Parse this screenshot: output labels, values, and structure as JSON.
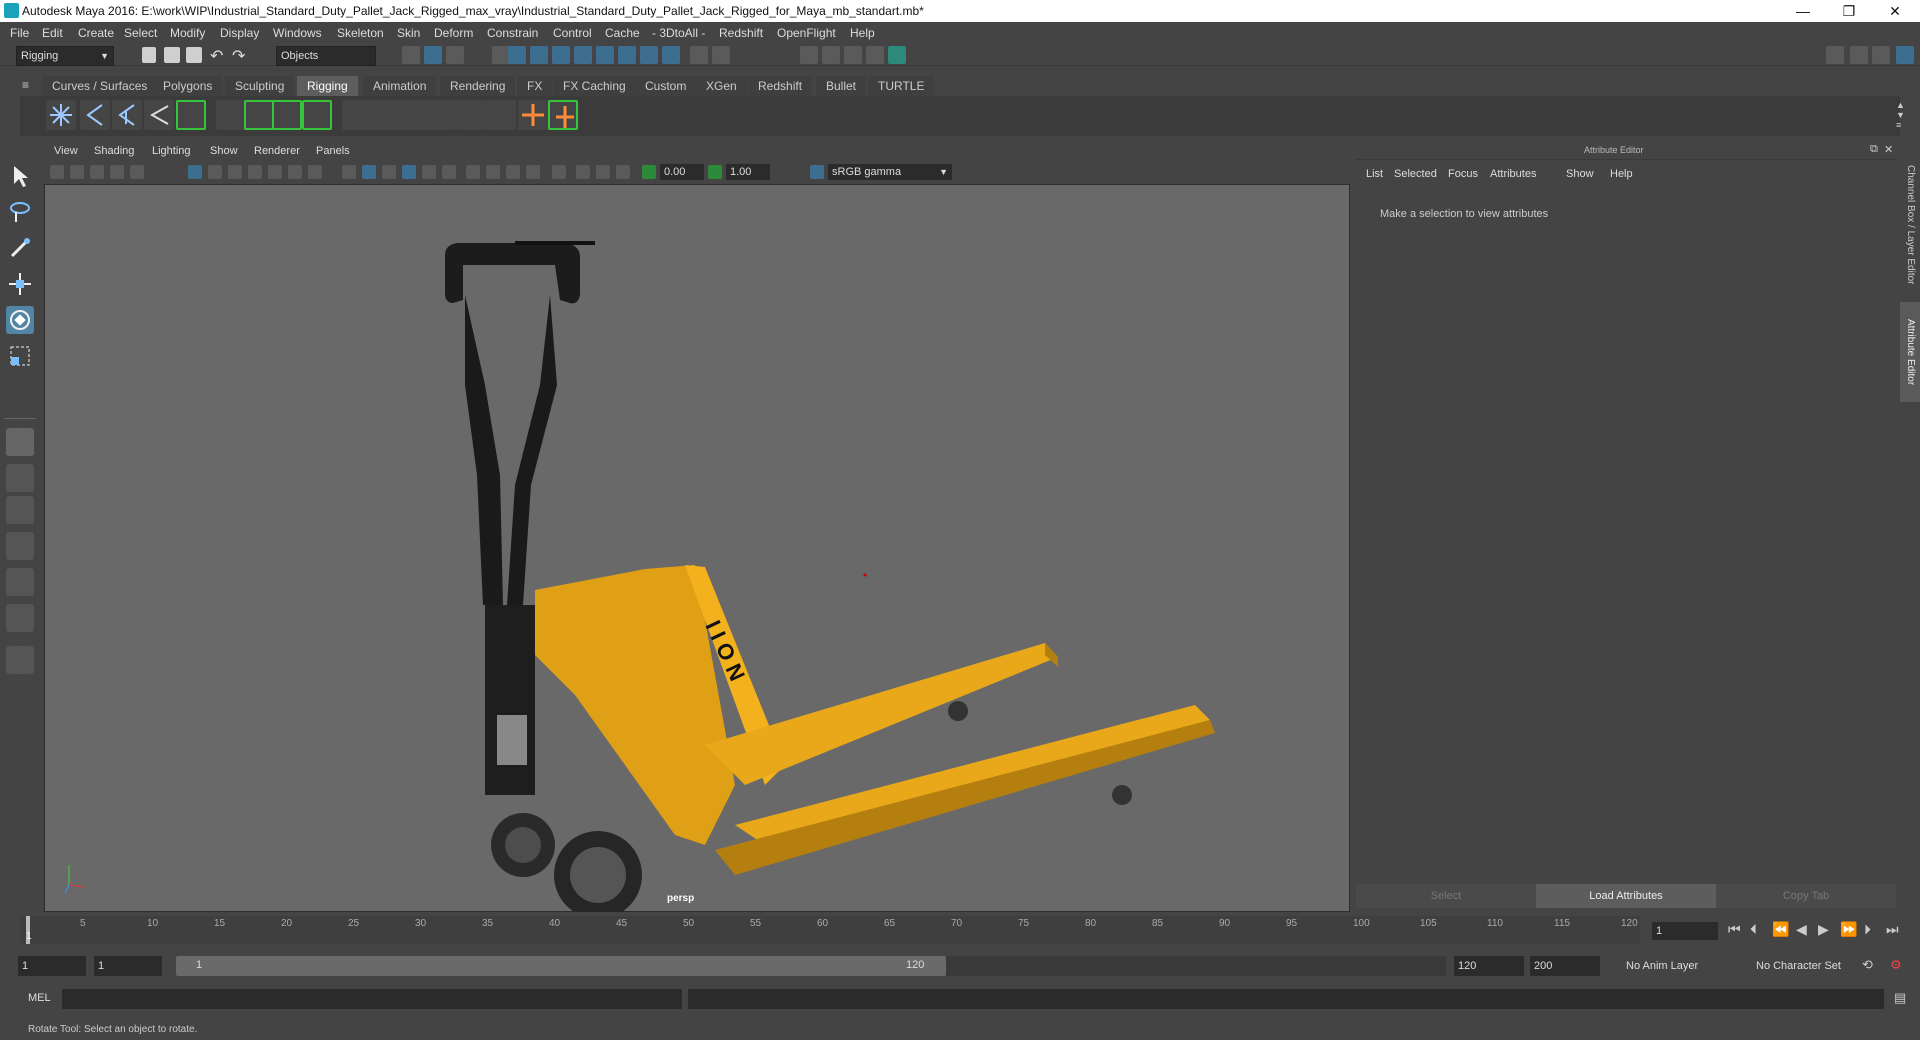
{
  "window": {
    "title": "Autodesk Maya 2016: E:\\work\\WIP\\Industrial_Standard_Duty_Pallet_Jack_Rigged_max_vray\\Industrial_Standard_Duty_Pallet_Jack_Rigged_for_Maya_mb_standart.mb*",
    "minimize": "—",
    "maximize": "❐",
    "close": "✕"
  },
  "menubar": [
    "File",
    "Edit",
    "Create",
    "Select",
    "Modify",
    "Display",
    "Windows",
    "Skeleton",
    "Skin",
    "Deform",
    "Constrain",
    "Control",
    "Cache",
    "- 3DtoAll -",
    "Redshift",
    "OpenFlight",
    "Help"
  ],
  "statusline": {
    "menuset": "Rigging",
    "selection_mode": "Objects"
  },
  "shelf_tabs": [
    "Curves / Surfaces",
    "Polygons",
    "Sculpting",
    "Rigging",
    "Animation",
    "Rendering",
    "FX",
    "FX Caching",
    "Custom",
    "XGen",
    "Redshift",
    "Bullet",
    "TURTLE"
  ],
  "shelf_active": "Rigging",
  "viewport": {
    "menus": [
      "View",
      "Shading",
      "Lighting",
      "Show",
      "Renderer",
      "Panels"
    ],
    "exposure": "0.00",
    "gamma": "1.00",
    "color_space": "sRGB gamma",
    "camera_label": "persp",
    "model_decal": "I I O N"
  },
  "attribute_editor": {
    "header": "Attribute Editor",
    "menus": [
      "List",
      "Selected",
      "Focus",
      "Attributes",
      "Show",
      "Help"
    ],
    "message": "Make a selection to view attributes",
    "buttons": {
      "select": "Select",
      "load": "Load Attributes",
      "copy_tab": "Copy Tab"
    }
  },
  "side_tabs": [
    "Channel Box / Layer Editor",
    "Attribute Editor"
  ],
  "timeslider": {
    "ticks": [
      "1",
      "5",
      "10",
      "15",
      "20",
      "25",
      "30",
      "35",
      "40",
      "45",
      "50",
      "55",
      "60",
      "65",
      "70",
      "75",
      "80",
      "85",
      "90",
      "95",
      "100",
      "105",
      "110",
      "115",
      "120"
    ],
    "current_frame": "1"
  },
  "range": {
    "start": "1",
    "playback_start": "1",
    "range_start_label": "1",
    "range_end_label": "120",
    "playback_end": "120",
    "end": "200",
    "anim_layer": "No Anim Layer",
    "character_set": "No Character Set"
  },
  "cmdline": {
    "label": "MEL"
  },
  "helpline": {
    "text": "Rotate Tool: Select an object to rotate."
  }
}
